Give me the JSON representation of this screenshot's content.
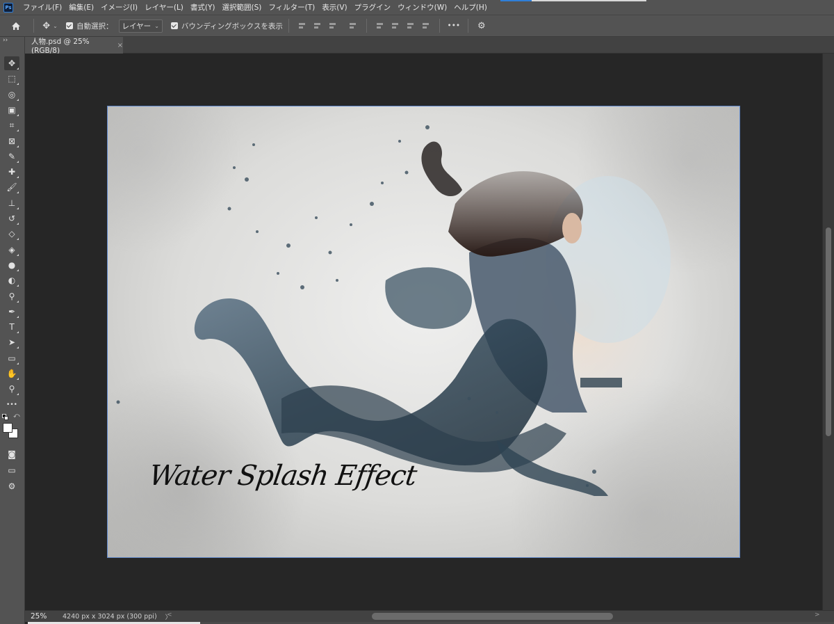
{
  "app": {
    "logo_text": "Ps"
  },
  "menu": {
    "items": [
      "ファイル(F)",
      "編集(E)",
      "イメージ(I)",
      "レイヤー(L)",
      "書式(Y)",
      "選択範囲(S)",
      "フィルター(T)",
      "表示(V)",
      "プラグイン",
      "ウィンドウ(W)",
      "ヘルプ(H)"
    ]
  },
  "options": {
    "auto_select_label": "自動選択：",
    "auto_select_value": "レイヤー",
    "bounding_box_label": "バウンディングボックスを表示",
    "more_label": "•••"
  },
  "document": {
    "tab_title": "人物.psd @ 25% (RGB/8)",
    "tab_close": "×",
    "artwork_title": "Water Splash Effect"
  },
  "status": {
    "zoom": "25%",
    "doc_size": "4240 px x 3024 px (300 ppi)",
    "expand_arrow": "〉",
    "scroll_left": "<",
    "scroll_right": ">"
  },
  "toolbar": {
    "collapse": "››",
    "tools": [
      {
        "name": "move-tool-icon",
        "glyph": "✥"
      },
      {
        "name": "marquee-tool-icon",
        "glyph": "⬚"
      },
      {
        "name": "object-select-tool-icon",
        "glyph": "◎"
      },
      {
        "name": "frame-select-tool-icon",
        "glyph": "▣"
      },
      {
        "name": "crop-tool-icon",
        "glyph": "⌗"
      },
      {
        "name": "frame-tool-icon",
        "glyph": "⊠"
      },
      {
        "name": "eyedropper-tool-icon",
        "glyph": "✎"
      },
      {
        "name": "healing-brush-tool-icon",
        "glyph": "✚"
      },
      {
        "name": "brush-tool-icon",
        "glyph": "🖌"
      },
      {
        "name": "clone-stamp-tool-icon",
        "glyph": "⊥"
      },
      {
        "name": "history-brush-tool-icon",
        "glyph": "↺"
      },
      {
        "name": "eraser-tool-icon",
        "glyph": "◇"
      },
      {
        "name": "paint-bucket-tool-icon",
        "glyph": "◈"
      },
      {
        "name": "blur-tool-icon",
        "glyph": "●"
      },
      {
        "name": "dodge-tool-icon",
        "glyph": "◐"
      },
      {
        "name": "sponge-tool-icon",
        "glyph": "⚲"
      },
      {
        "name": "pen-tool-icon",
        "glyph": "✒"
      },
      {
        "name": "type-tool-icon",
        "glyph": "T"
      },
      {
        "name": "path-selection-tool-icon",
        "glyph": "➤"
      },
      {
        "name": "rectangle-tool-icon",
        "glyph": "▭"
      },
      {
        "name": "hand-tool-icon",
        "glyph": "✋"
      },
      {
        "name": "zoom-tool-icon",
        "glyph": "⚲"
      },
      {
        "name": "more-tools-icon",
        "glyph": "•••"
      }
    ],
    "quick_mask_glyph": "◙",
    "screen_mode_glyph": "▭",
    "generative_glyph": "⚙"
  },
  "colors": {
    "foreground": "#ffffff",
    "background": "#ffffff",
    "ui_dark": "#262626",
    "ui_panel": "#535353",
    "selection_border": "#5e86c9"
  }
}
